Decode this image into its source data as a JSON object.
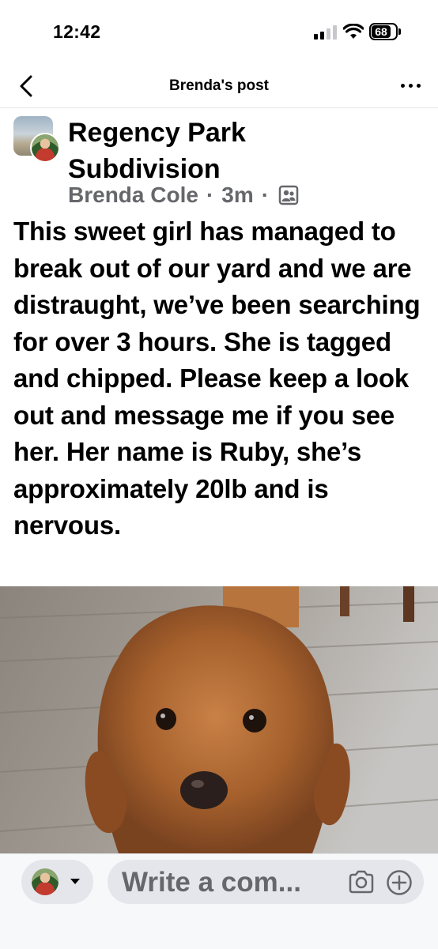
{
  "status_bar": {
    "time": "12:42",
    "battery": "68"
  },
  "nav": {
    "title": "Brenda's post",
    "back_icon": "chevron-left-icon",
    "more_icon": "more-horizontal-icon"
  },
  "post": {
    "group_name": "Regency Park Subdivision",
    "author": "Brenda Cole",
    "time": "3m",
    "separator": "·",
    "audience_icon": "members-icon",
    "text": "This sweet girl has managed to break out of our yard and we are distraught, we’ve been searching for over 3 hours. She is tagged and chipped. Please keep a look out and message me if you see her. Her name is Ruby, she’s approximately 20lb and is nervous."
  },
  "comment_bar": {
    "placeholder": "Write a com...",
    "camera_icon": "camera-icon",
    "add_icon": "plus-circle-icon"
  }
}
